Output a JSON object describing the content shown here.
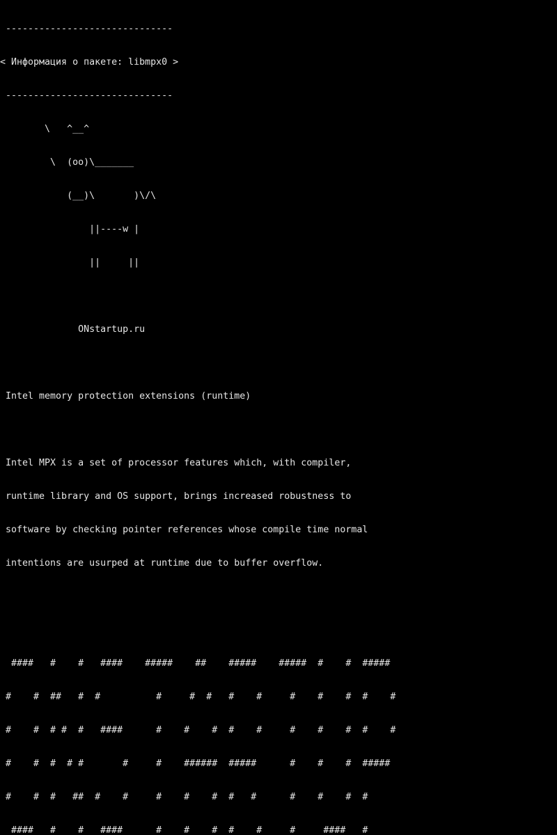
{
  "screen": {
    "lines": [
      " ------------------------------",
      "< Информация о пакете: libmpx0 >",
      " ------------------------------",
      "        \\   ^__^",
      "         \\  (oo)\\_______",
      "            (__)\\       )\\/\\",
      "                ||----w |",
      "                ||     ||",
      "",
      "              ONstartup.ru",
      "",
      " Intel memory protection extensions (runtime)",
      "",
      " Intel MPX is a set of processor features which, with compiler,",
      " runtime library and OS support, brings increased robustness to",
      " software by checking pointer references whose compile time normal",
      " intentions are usurped at runtime due to buffer overflow.",
      "",
      "",
      "  ####   #    #   ####    #####    ##    #####    #####  #    #  #####",
      " #    #  ##   #  #          #     #  #   #    #     #    #    #  #    #",
      " #    #  # #  #   ####      #    #    #  #    #     #    #    #  #    #",
      " #    #  #  # #       #     #    ######  #####      #    #    #  #####",
      " #    #  #   ##  #    #     #    #    #  #   #      #    #    #  #",
      "  ####   #    #   ####      #    #    #  #    #     #     ####   #"
    ]
  }
}
